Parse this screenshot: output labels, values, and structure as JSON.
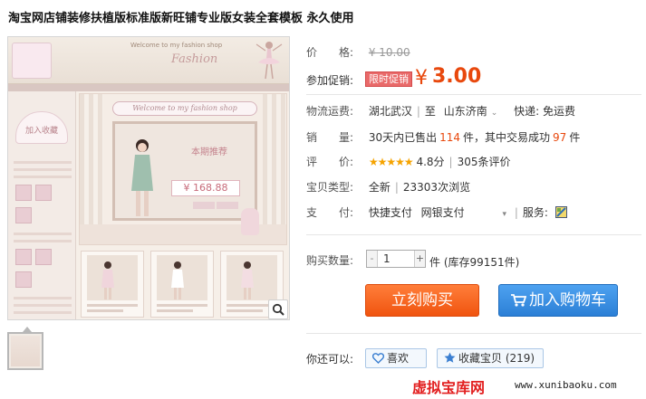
{
  "title": "淘宝网店铺装修扶植版标准版新旺铺专业版女装全套模板 永久使用",
  "image": {
    "shop_caption": "Welcome to my fashion shop",
    "shop_script": "Fashion",
    "side_tag": "加入收藏",
    "banner_welcome": "Welcome to my fashion shop",
    "promo_title": "本期推荐",
    "promo_price": "¥ 168.88"
  },
  "details": {
    "price_label": "价　　格:",
    "original_price": "¥ 10.00",
    "promo_label": "参加促销:",
    "promo_tag": "限时促销",
    "currency": "¥",
    "promo_price": "3.00",
    "shipping_label": "物流运费:",
    "from": "湖北武汉",
    "to_prefix": "至",
    "to": "山东济南",
    "express": "快递: 免运费",
    "sales_label": "销　　量:",
    "sales_prefix": "30天内已售出",
    "sales_count": "114",
    "sales_mid": "件，其中交易成功",
    "sales_success": "97",
    "sales_suffix": "件",
    "rating_label": "评　　价:",
    "rating_stars": "★★★★★",
    "rating_score": "4.8分",
    "review_count": "305条评价",
    "type_label": "宝贝类型:",
    "condition": "全新",
    "views": "23303次浏览",
    "payment_label": "支　　付:",
    "pay1": "快捷支付",
    "pay2": "网银支付",
    "service_label": "服务:",
    "qty_label": "购买数量:",
    "qty_value": "1",
    "qty_minus": "-",
    "qty_plus": "+",
    "stock": "件 (库存99151件)",
    "buy_label": "立刻购买",
    "cart_label": "加入购物车",
    "share_label": "你还可以:",
    "like_label": "喜欢",
    "collect_label": "收藏宝贝 (219)"
  },
  "watermark": {
    "site_name": "虚拟宝库网",
    "url": "www.xunibaoku.com"
  },
  "colors": {
    "accent_orange": "#e8480d",
    "buy_button": "#f0540f",
    "cart_button": "#2b7fd6",
    "promo_tag": "#e96a6a",
    "star": "#f5a300"
  },
  "icons": [
    "zoom-icon",
    "dropdown-arrow-icon",
    "service-icon",
    "cart-icon",
    "heart-icon",
    "star-icon"
  ]
}
